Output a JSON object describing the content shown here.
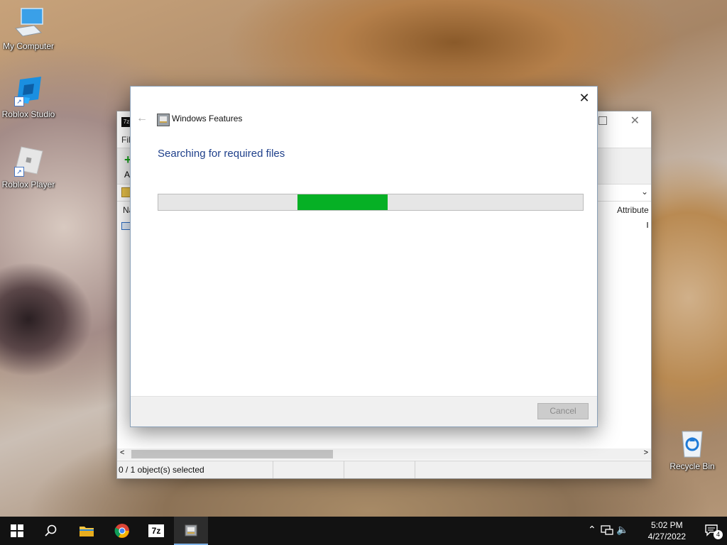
{
  "desktop": {
    "icons": [
      {
        "label": "My Computer",
        "icon": "computer-icon"
      },
      {
        "label": "Roblox Studio",
        "icon": "roblox-studio-icon"
      },
      {
        "label": "Roblox Player",
        "icon": "roblox-player-icon"
      },
      {
        "label": "Recycle Bin",
        "icon": "recycle-bin-icon"
      }
    ]
  },
  "sevenzip": {
    "menu_fragment": "Fil",
    "toolbar_fragment": "A",
    "column_name_fragment": "Na",
    "column_attributes": "Attribute",
    "status_selected": "0 / 1 object(s) selected"
  },
  "dialog": {
    "title": "Windows Features",
    "heading": "Searching for required files",
    "progress_fraction": 0.21,
    "cancel_label": "Cancel",
    "colors": {
      "heading": "#1e3f8a",
      "progress_fill": "#06b025"
    }
  },
  "taskbar": {
    "items": [
      {
        "name": "start",
        "icon": "windows-start-icon"
      },
      {
        "name": "search",
        "icon": "search-icon"
      },
      {
        "name": "file-explorer",
        "icon": "folder-icon"
      },
      {
        "name": "chrome",
        "icon": "chrome-icon"
      },
      {
        "name": "7zip",
        "icon": "7zip-icon",
        "label": "7z"
      },
      {
        "name": "windows-features",
        "icon": "windows-features-icon",
        "active": true
      }
    ],
    "clock_time": "5:02 PM",
    "clock_date": "4/27/2022",
    "notification_count": "4"
  }
}
